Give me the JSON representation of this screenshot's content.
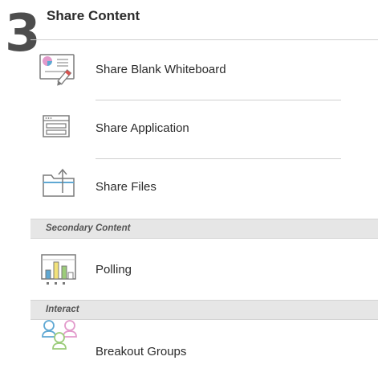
{
  "step_number": "3",
  "panel_title": "Share Content",
  "items": [
    {
      "label": "Share Blank Whiteboard",
      "icon": "whiteboard-icon"
    },
    {
      "label": "Share Application",
      "icon": "application-window-icon"
    },
    {
      "label": "Share Files",
      "icon": "folder-upload-icon"
    }
  ],
  "sections": [
    {
      "header": "Secondary Content",
      "items": [
        {
          "label": "Polling",
          "icon": "polling-chart-icon"
        }
      ]
    },
    {
      "header": "Interact",
      "items": [
        {
          "label": "Breakout Groups",
          "icon": "breakout-groups-icon"
        }
      ]
    }
  ],
  "colors": {
    "section_header_bg": "#e6e6e6",
    "divider": "#cfcfcf",
    "accent_blue": "#5fa8d3",
    "accent_yellow": "#f2e27a",
    "accent_green": "#9ccc7a",
    "accent_pink": "#e29acb",
    "accent_red": "#d9534f"
  }
}
